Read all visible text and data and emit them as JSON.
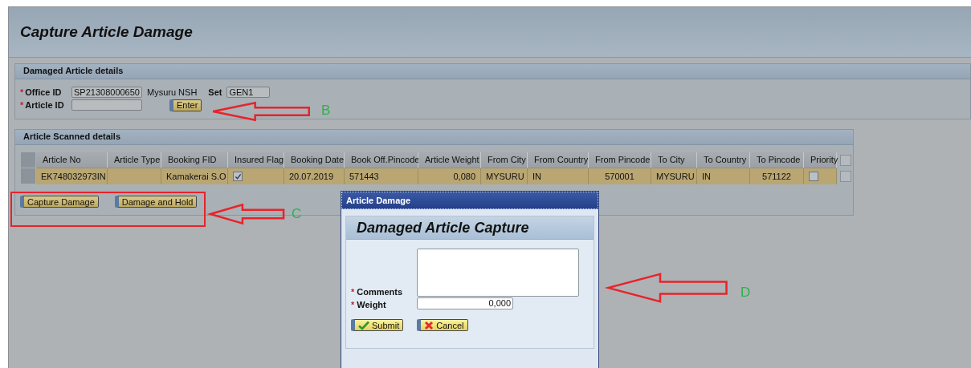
{
  "window": {
    "title": "Capture Article Damage"
  },
  "details": {
    "title": "Damaged Article details",
    "office": {
      "label": "Office ID",
      "marker": "*",
      "value": "SP21308000650",
      "name": "Mysuru NSH"
    },
    "set": {
      "label": "Set",
      "value": "GEN1"
    },
    "article": {
      "label": "Article ID",
      "marker": "*"
    },
    "button": "Enter"
  },
  "scanned": {
    "title": "Article Scanned details",
    "columns": [
      "Article No",
      "Article Type",
      "Booking FID",
      "Insured Flag",
      "Booking Date",
      "Book Off.Pincode",
      "Article Weight",
      "From City",
      "From Country",
      "From Pincode",
      "To City",
      "To Country",
      "To Pincode",
      "Priority"
    ],
    "rows": [
      {
        "cells": [
          {
            "kind": "text",
            "text": "EK748032973IN"
          },
          {
            "kind": "text"
          },
          {
            "kind": "text",
            "text": "Kamakerai S.O"
          },
          {
            "kind": "checkbox",
            "checked": true
          },
          {
            "kind": "text",
            "text": "20.07.2019"
          },
          {
            "kind": "text",
            "text": "571443"
          },
          {
            "kind": "text",
            "text": "0,080"
          },
          {
            "kind": "text",
            "text": "MYSURU"
          },
          {
            "kind": "text",
            "text": "IN"
          },
          {
            "kind": "text",
            "text": "570001"
          },
          {
            "kind": "text",
            "text": "MYSURU"
          },
          {
            "kind": "text",
            "text": "IN"
          },
          {
            "kind": "text",
            "text": "571122"
          },
          {
            "kind": "checkbox",
            "checked": false
          }
        ]
      }
    ],
    "buttons": [
      "Capture Damage",
      "Damage and Hold"
    ]
  },
  "dialog": {
    "title": "Article Damage",
    "heading": "Damaged Article Capture",
    "fields": [
      {
        "kind": "textarea",
        "label": "Comments",
        "marker": "*"
      },
      {
        "kind": "number",
        "label": "Weight",
        "marker": "*",
        "value": "0,000"
      }
    ],
    "buttons": [
      {
        "kind": "submit",
        "label": "Submit"
      },
      {
        "kind": "cancel",
        "label": "Cancel"
      }
    ]
  },
  "annotations": [
    {
      "label": "B"
    },
    {
      "label": "C"
    },
    {
      "label": "D"
    }
  ]
}
